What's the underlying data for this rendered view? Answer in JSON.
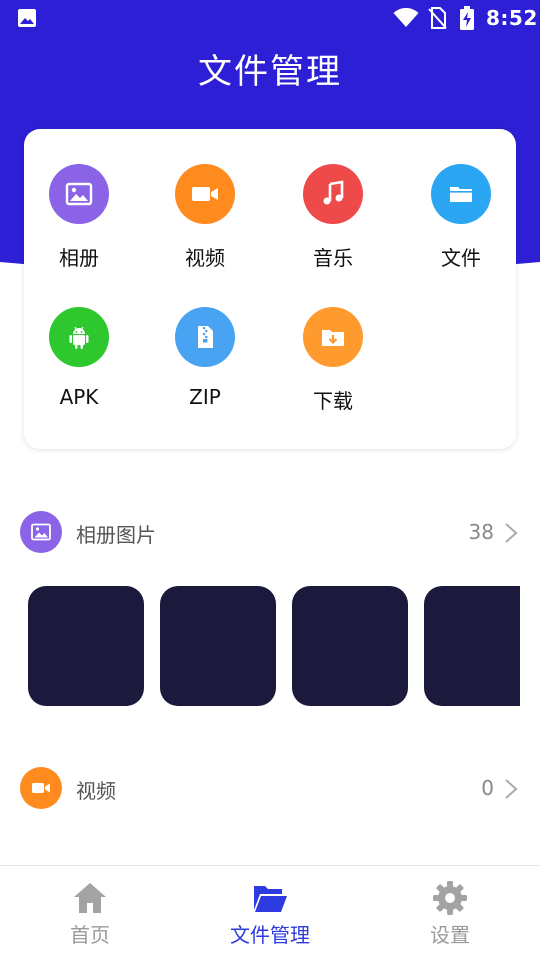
{
  "status_bar": {
    "time": "8:52"
  },
  "header": {
    "title": "文件管理"
  },
  "categories": [
    {
      "label": "相册",
      "icon": "image-icon",
      "color": "#8a63e6"
    },
    {
      "label": "视频",
      "icon": "video-icon",
      "color": "#ff8a1e"
    },
    {
      "label": "音乐",
      "icon": "music-icon",
      "color": "#ef4a4a"
    },
    {
      "label": "文件",
      "icon": "folder-icon",
      "color": "#2aa6f2"
    },
    {
      "label": "APK",
      "icon": "android-icon",
      "color": "#2ec72e"
    },
    {
      "label": "ZIP",
      "icon": "zip-icon",
      "color": "#49a3f3"
    },
    {
      "label": "下载",
      "icon": "download-folder-icon",
      "color": "#ff9a2e"
    }
  ],
  "sections": {
    "photos": {
      "title": "相册图片",
      "count": "38",
      "icon": "image-icon",
      "color": "#8a63e6"
    },
    "videos": {
      "title": "视频",
      "count": "0",
      "icon": "video-icon",
      "color": "#ff8a1e"
    }
  },
  "bottom_nav": [
    {
      "label": "首页",
      "icon": "home-icon",
      "active": false
    },
    {
      "label": "文件管理",
      "icon": "folder-open-icon",
      "active": true
    },
    {
      "label": "设置",
      "icon": "gear-icon",
      "active": false
    }
  ],
  "colors": {
    "brand": "#2d1fd6",
    "nav_active": "#2d3be0",
    "nav_inactive": "#9a9a9a",
    "thumbnail": "#1b1a3c"
  }
}
